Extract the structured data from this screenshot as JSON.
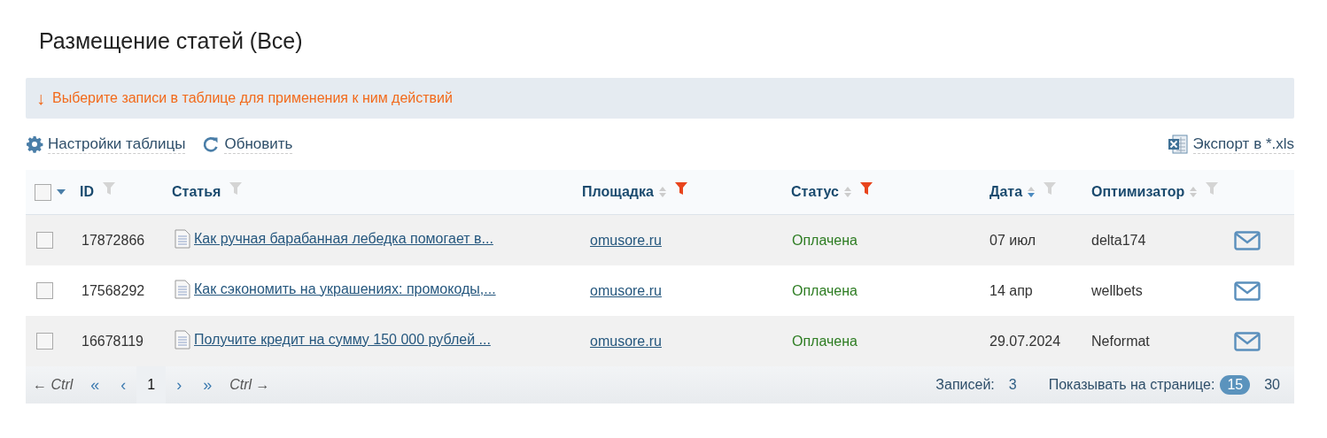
{
  "title": "Размещение статей (Все)",
  "alert": {
    "icon": "↓",
    "text": "Выберите записи в таблице для применения к ним действий"
  },
  "toolbar": {
    "settings": "Настройки таблицы",
    "refresh": "Обновить",
    "export": "Экспорт в *.xls"
  },
  "table": {
    "select_all": {
      "checked": false
    },
    "columns": [
      {
        "label": "ID",
        "filter_active": false
      },
      {
        "label": "Статья",
        "filter_active": false
      },
      {
        "label": "Площадка",
        "sorted_desc": false,
        "filter_active": true
      },
      {
        "label": "Статус",
        "sorted_desc": false,
        "filter_active": true
      },
      {
        "label": "Дата",
        "sorted_desc": true,
        "filter_active": false
      },
      {
        "label": "Оптимизатор",
        "sorted_desc": false,
        "filter_active": false
      }
    ],
    "rows": [
      {
        "checked": false,
        "id": "17872866",
        "article": "Как ручная барабанная лебедка помогает в...",
        "site": "omusore.ru",
        "status": "Оплачена",
        "date": "07 июл",
        "optimizer": "delta174"
      },
      {
        "checked": false,
        "id": "17568292",
        "article": "Как сэкономить на украшениях: промокоды,...",
        "site": "omusore.ru",
        "status": "Оплачена",
        "date": "14 апр",
        "optimizer": "wellbets"
      },
      {
        "checked": false,
        "id": "16678119",
        "article": "Получите кредит на сумму 150 000 рублей ...",
        "site": "omusore.ru",
        "status": "Оплачена",
        "date": "29.07.2024",
        "optimizer": "Neformat"
      }
    ]
  },
  "pagination": {
    "prev_hint": "← Ctrl",
    "first": "«",
    "prev": "‹",
    "pages": [
      {
        "label": "1",
        "selected": true
      }
    ],
    "next": "›",
    "last": "»",
    "next_hint": "Ctrl →",
    "records_label": "Записей:",
    "records_count": "3",
    "page_size_label": "Показывать на странице:",
    "page_sizes": [
      {
        "label": "15",
        "selected": true
      },
      {
        "label": "30",
        "selected": false
      }
    ]
  }
}
